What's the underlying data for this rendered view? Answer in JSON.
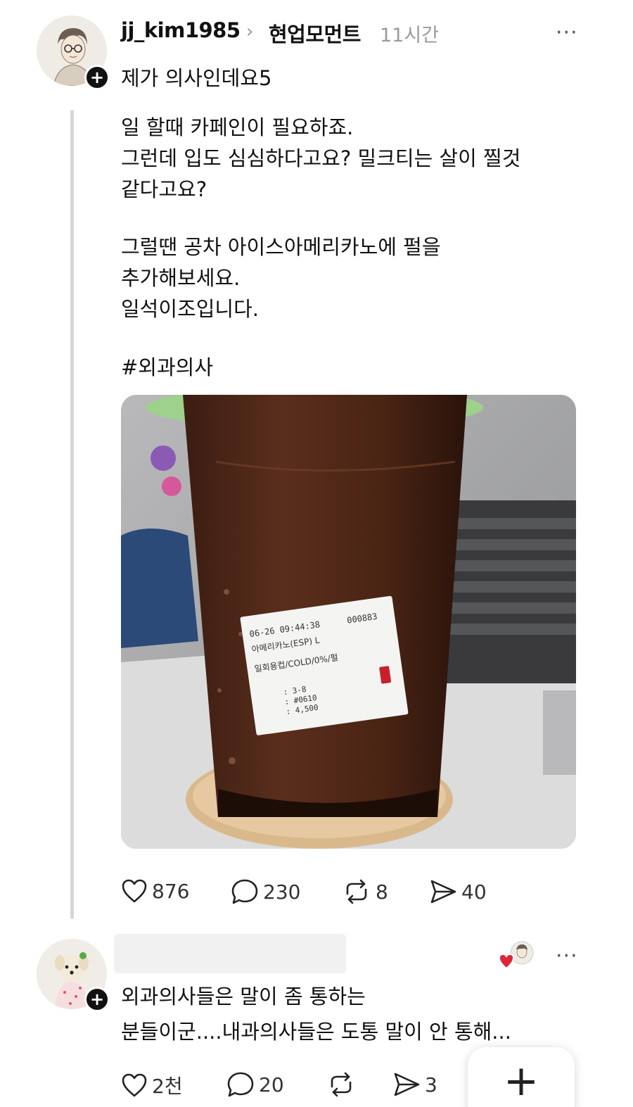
{
  "post": {
    "username": "jj_kim1985",
    "topic": "현업모먼트",
    "time": "11시간",
    "title": "제가 의사인데요5",
    "lines": [
      "일 할때 카페인이 필요하죠.",
      "그런데 입도 심심하다고요? 밀크티는 살이 찔것",
      "같다고요?",
      "그럴땐 공차 아이스아메리카노에 펄을",
      "추가해보세요.",
      "일석이조입니다."
    ],
    "hashtag": "#외과의사",
    "photo": {
      "receipt": {
        "datetime": "06-26 09:44:38",
        "number": "000883",
        "item": "아메리카노(ESP) L",
        "options": "일회용컵/COLD/0%/펄",
        "line1": ": 3-8",
        "line2": ": #0610",
        "line3": ": 4,500"
      }
    },
    "actions": {
      "likes": "876",
      "comments": "230",
      "reposts": "8",
      "shares": "40"
    }
  },
  "reply": {
    "lines": [
      "외과의사들은 말이 좀 통하는",
      "분들이군....내과의사들은 도통 말이 안 통해..."
    ],
    "actions": {
      "likes": "2천",
      "comments": "20",
      "shares": "3"
    }
  },
  "icons": {
    "follow": "+",
    "fab": "+",
    "more": "···",
    "chevron": "›"
  },
  "colors": {
    "liked_heart": "#e0243a",
    "muted_text": "#9a9a9a"
  }
}
